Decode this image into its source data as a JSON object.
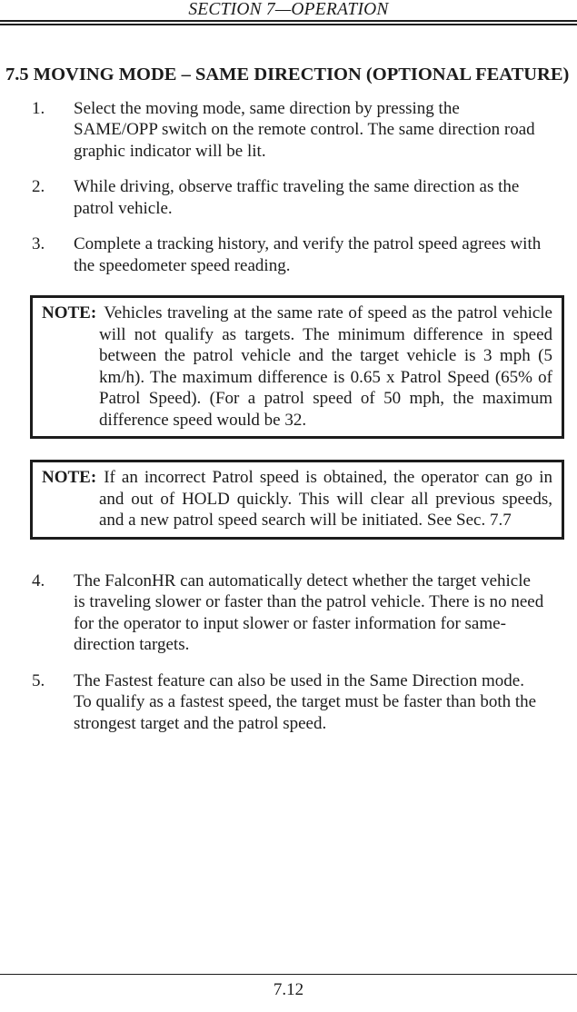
{
  "header": {
    "running_title": "SECTION 7—OPERATION"
  },
  "section": {
    "number": "7.5",
    "title": "MOVING MODE – SAME DIRECTION (OPTIONAL FEATURE)",
    "heading_full": "7.5 MOVING MODE – SAME DIRECTION (OPTIONAL FEATURE)"
  },
  "steps": [
    {
      "number": "1.",
      "text": "Select the moving mode, same direction by pressing the SAME/OPP switch on the remote control.  The same direction road graphic indicator will be lit."
    },
    {
      "number": "2.",
      "text": "While driving, observe traffic traveling the same direction as the patrol vehicle."
    },
    {
      "number": "3.",
      "text": "Complete a tracking history, and verify the patrol speed agrees with the speedometer speed reading."
    },
    {
      "number": "4.",
      "text": "The FalconHR can automatically detect whether the target vehicle is traveling slower or faster than the patrol vehicle.  There is no need for the operator to input slower or faster information for same-direction targets."
    },
    {
      "number": "5.",
      "text": "The Fastest feature can also be used in the Same Direction mode.  To qualify as a fastest speed, the target must be faster than both the strongest target and the patrol speed."
    }
  ],
  "notes": [
    {
      "label": "NOTE:",
      "text": "Vehicles traveling at the same rate of speed as the patrol vehicle will not qualify as targets.  The minimum difference in speed between the patrol vehicle and the target vehicle is 3 mph (5 km/h).  The maximum difference is 0.65 x Patrol Speed (65% of Patrol Speed).   (For a patrol speed of 50 mph, the maximum difference speed would be 32."
    },
    {
      "label": "NOTE:",
      "text": "If an incorrect Patrol speed is obtained, the operator can go in and out of HOLD quickly.  This will clear all previous speeds, and a new patrol speed search will be initiated. See Sec. 7.7"
    }
  ],
  "footer": {
    "page_number": "7.12"
  },
  "colors": {
    "text": "#1c1c1c",
    "rule": "#1c1c1c",
    "background": "#ffffff"
  }
}
